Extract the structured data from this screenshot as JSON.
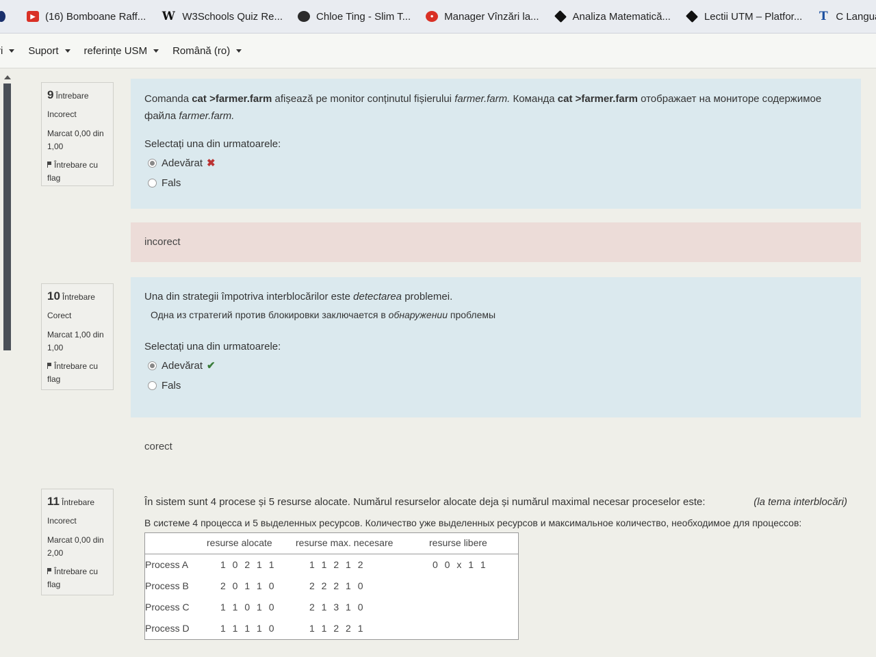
{
  "bookmarks": [
    {
      "icon": "youtube-icon",
      "label": "(16) Bomboane Raff..."
    },
    {
      "icon": "w3schools-icon",
      "label": "W3Schools Quiz Re..."
    },
    {
      "icon": "avatar-icon",
      "label": "Chloe Ting - Slim T..."
    },
    {
      "icon": "search-pin-icon",
      "label": "Manager Vînzări la..."
    },
    {
      "icon": "graduation-cap-icon",
      "label": "Analiza Matematică..."
    },
    {
      "icon": "graduation-cap-icon",
      "label": "Lectii UTM – Platfor..."
    },
    {
      "icon": "text-t-icon",
      "label": "C Languag"
    }
  ],
  "navbar": {
    "items": [
      "ri",
      "Suport",
      "referințe USM",
      "Română (ro)"
    ]
  },
  "questions": [
    {
      "number": "9",
      "label": "Întrebare",
      "state": "Incorect",
      "grade": "Marcat 0,00 din 1,00",
      "flag": "Întrebare cu flag",
      "text_ro_1": "Comanda ",
      "cmd_a": "cat >farmer.farm",
      "text_ro_2": " afișează pe monitor conținutul fișierului ",
      "file_a": "farmer.farm.",
      "text_ru_1": "  Команда ",
      "cmd_b": "cat >farmer.farm",
      "text_ru_2": " отображает на мониторе содержимое файла  ",
      "file_b": "farmer.farm.",
      "prompt": "Selectați una din urmatoarele:",
      "options": [
        "Adevărat",
        "Fals"
      ],
      "selected": "Adevărat",
      "feedback": "incorect",
      "color": "#ecdcd8"
    },
    {
      "number": "10",
      "label": "Întrebare",
      "state": "Corect",
      "grade": "Marcat 1,00 din 1,00",
      "flag": "Întrebare cu flag",
      "text_ro_1": "Una din strategii împotriva interblocărilor este ",
      "em_ro": "detectarea",
      "text_ro_2": " problemei.",
      "text_ru_1": "Одна из стратегий против блокировки заключается в ",
      "em_ru": "обнаружении",
      "text_ru_2": " проблемы",
      "prompt": "Selectați una din urmatoarele:",
      "options": [
        "Adevărat",
        "Fals"
      ],
      "selected": "Adevărat",
      "feedback": "corect"
    },
    {
      "number": "11",
      "label": "Întrebare",
      "state": "Incorect",
      "grade": "Marcat 0,00 din 2,00",
      "flag": "Întrebare cu flag",
      "text_ro": "În sistem sunt 4 procese și 5 resurse alocate. Numărul resurselor alocate deja și numărul maximal necesar proceselor este:",
      "topic": "(la tema interblocări)",
      "text_ru": "В системе 4 процесса и 5 выделенных ресурсов. Количество уже выделенных ресурсов и максимальное количество, необходимое для процессов:",
      "table": {
        "headers": [
          "",
          "resurse alocate",
          "resurse max. necesare",
          "resurse libere"
        ],
        "rows": [
          [
            "Process A",
            "1 0 2 1 1",
            "1 1 2 1 2",
            "0 0 x 1 1"
          ],
          [
            "Process B",
            "2 0 1 1 0",
            "2 2 2 1 0",
            ""
          ],
          [
            "Process C",
            "1 1 0 1 0",
            "2 1 3 1 0",
            ""
          ],
          [
            "Process D",
            "1 1 1 1 0",
            "1 1 2 2 1",
            ""
          ]
        ]
      }
    }
  ]
}
